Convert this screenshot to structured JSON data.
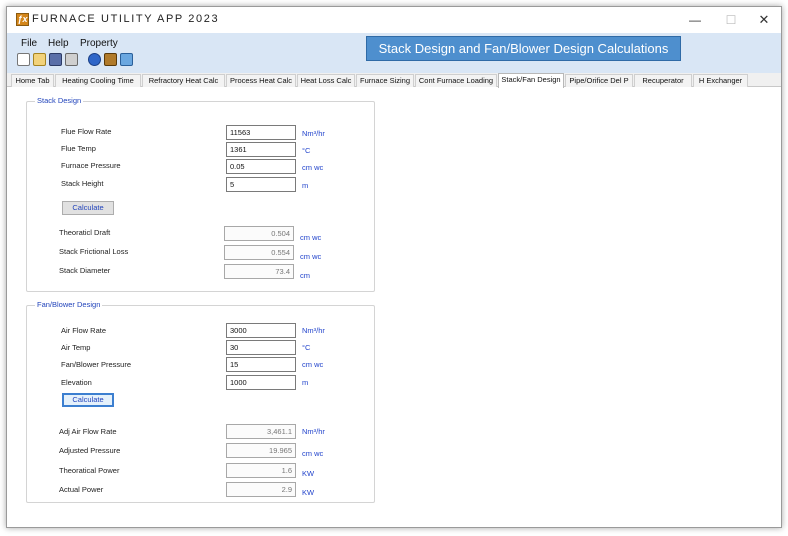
{
  "window": {
    "title": "FURNACE UTILITY APP 2023",
    "icon_text": "ƒx"
  },
  "menu": {
    "file": "File",
    "help": "Help",
    "property": "Property"
  },
  "banner": "Stack Design and Fan/Blower Design Calculations",
  "toolbar": [
    "new-icon",
    "open-icon",
    "save-icon",
    "print-icon",
    "help-icon",
    "tools-icon",
    "document-icon"
  ],
  "tabs": [
    {
      "label": "Home Tab"
    },
    {
      "label": "Heating Cooling Time"
    },
    {
      "label": "Refractory Heat Calc"
    },
    {
      "label": "Process Heat Calc"
    },
    {
      "label": "Heat Loss Calc"
    },
    {
      "label": "Furnace Sizing"
    },
    {
      "label": "Cont Furnace Loading"
    },
    {
      "label": "Stack/Fan Design"
    },
    {
      "label": "Pipe/Orifice Del P"
    },
    {
      "label": "Recuperator"
    },
    {
      "label": "H Exchanger"
    }
  ],
  "stack": {
    "title": "Stack Design",
    "inputs": [
      {
        "label": "Flue Flow Rate",
        "value": "11563",
        "unit": "Nm³/hr"
      },
      {
        "label": "Flue Temp",
        "value": "1361",
        "unit": "°C"
      },
      {
        "label": "Furnace Pressure",
        "value": "0.05",
        "unit": "cm wc"
      },
      {
        "label": "Stack Height",
        "value": "5",
        "unit": "m"
      }
    ],
    "button": "Calculate",
    "outputs": [
      {
        "label": "Theoraticl Draft",
        "value": "0.504",
        "unit": "cm wc"
      },
      {
        "label": "Stack  Frictional Loss",
        "value": "0.554",
        "unit": "cm wc"
      },
      {
        "label": "Stack  Diameter",
        "value": "73.4",
        "unit": "cm"
      }
    ]
  },
  "fan": {
    "title": "Fan/Blower Design",
    "inputs": [
      {
        "label": "Air Flow Rate",
        "value": "3000",
        "unit": "Nm³/hr"
      },
      {
        "label": "Air Temp",
        "value": "30",
        "unit": "°C"
      },
      {
        "label": "Fan/Blower Pressure",
        "value": "15",
        "unit": "cm wc"
      },
      {
        "label": "Elevation",
        "value": "1000",
        "unit": "m"
      }
    ],
    "button": "Calculate",
    "outputs": [
      {
        "label": "Adj Air Flow Rate",
        "value": "3,461.1",
        "unit": "Nm³/hr"
      },
      {
        "label": "Adjusted Pressure",
        "value": "19.965",
        "unit": "cm wc"
      },
      {
        "label": "Theoratical Power",
        "value": "1.6",
        "unit": "KW"
      },
      {
        "label": "Actual Power",
        "value": "2.9",
        "unit": "KW"
      }
    ]
  }
}
